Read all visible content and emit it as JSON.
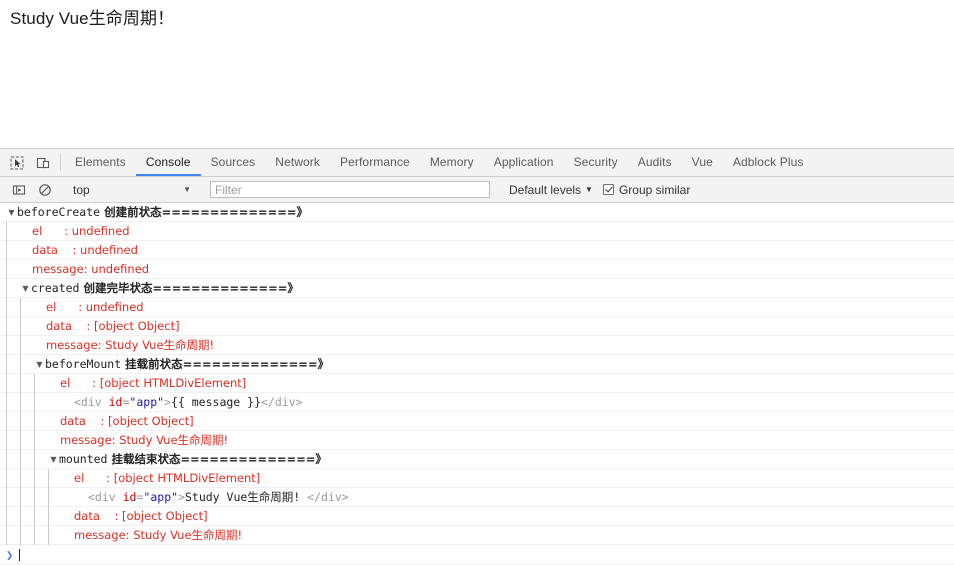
{
  "page": {
    "app_text": "Study Vue生命周期！"
  },
  "devtools": {
    "toolbar": {
      "inspect_icon": "inspect-cursor-icon",
      "device_icon": "device-toolbar-icon",
      "tabs": [
        {
          "label": "Elements",
          "selected": false
        },
        {
          "label": "Console",
          "selected": true
        },
        {
          "label": "Sources",
          "selected": false
        },
        {
          "label": "Network",
          "selected": false
        },
        {
          "label": "Performance",
          "selected": false
        },
        {
          "label": "Memory",
          "selected": false
        },
        {
          "label": "Application",
          "selected": false
        },
        {
          "label": "Security",
          "selected": false
        },
        {
          "label": "Audits",
          "selected": false
        },
        {
          "label": "Vue",
          "selected": false
        },
        {
          "label": "Adblock Plus",
          "selected": false
        }
      ],
      "accent_color": "#4285f4"
    },
    "filterbar": {
      "sidebar_icon": "console-sidebar-icon",
      "clear_icon": "clear-console-icon",
      "context_value": "top",
      "context_caret": "▼",
      "filter_placeholder": "Filter",
      "filter_value": "",
      "levels_label": "Default levels",
      "levels_caret": "▼",
      "group_similar_label": "Group similar",
      "group_similar_checked": true
    },
    "prompt": {
      "chevron": "❯",
      "value": ""
    }
  },
  "console_log": {
    "text_color": "#d93025",
    "rows": [
      {
        "kind": "group",
        "depth": 0,
        "arrow": "▼",
        "name": "beforeCreate",
        "cn": " 创建前状态==============》"
      },
      {
        "kind": "prop",
        "depth": 1,
        "text": "el      : undefined"
      },
      {
        "kind": "prop",
        "depth": 1,
        "text": "data    : undefined"
      },
      {
        "kind": "prop",
        "depth": 1,
        "text": "message: undefined"
      },
      {
        "kind": "group",
        "depth": 1,
        "arrow": "▼",
        "name": "created",
        "cn": " 创建完毕状态==============》"
      },
      {
        "kind": "prop",
        "depth": 2,
        "text": "el      : undefined"
      },
      {
        "kind": "prop",
        "depth": 2,
        "text": "data    : [object Object]"
      },
      {
        "kind": "prop",
        "depth": 2,
        "text": "message: Study Vue生命周期!"
      },
      {
        "kind": "group",
        "depth": 2,
        "arrow": "▼",
        "name": "beforeMount",
        "cn": " 挂载前状态==============》"
      },
      {
        "kind": "prop",
        "depth": 3,
        "text": "el      : [object HTMLDivElement]"
      },
      {
        "kind": "html",
        "depth": 3,
        "open_lt": "<div ",
        "attr": "id",
        "eq": "=",
        "val": "\"app\"",
        "gt": ">",
        "inner": "{{ message }}",
        "close": "</div>"
      },
      {
        "kind": "prop",
        "depth": 3,
        "text": "data    : [object Object]"
      },
      {
        "kind": "prop",
        "depth": 3,
        "text": "message: Study Vue生命周期!"
      },
      {
        "kind": "group",
        "depth": 3,
        "arrow": "▼",
        "name": "mounted",
        "cn": " 挂载结束状态==============》"
      },
      {
        "kind": "prop",
        "depth": 4,
        "text": "el      : [object HTMLDivElement]"
      },
      {
        "kind": "html",
        "depth": 4,
        "open_lt": "<div ",
        "attr": "id",
        "eq": "=",
        "val": "\"app\"",
        "gt": ">",
        "inner": "Study Vue生命周期! ",
        "close": "</div>"
      },
      {
        "kind": "prop",
        "depth": 4,
        "text": "data    : [object Object]"
      },
      {
        "kind": "prop",
        "depth": 4,
        "text": "message: Study Vue生命周期!"
      }
    ]
  }
}
